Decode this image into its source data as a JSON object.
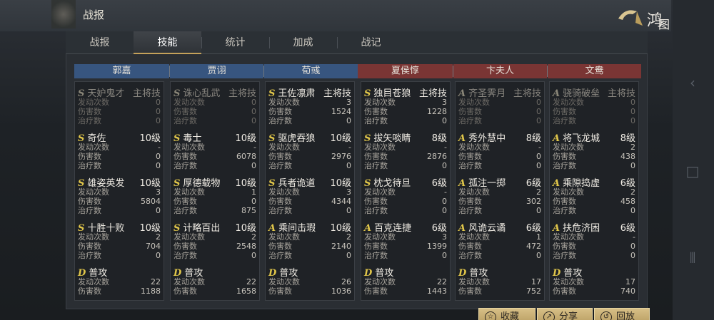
{
  "header": {
    "title": "战报",
    "brand": "鸿图之下"
  },
  "tabs": [
    "战报",
    "技能",
    "统计",
    "加成",
    "战记"
  ],
  "generals": [
    "郭嘉",
    "贾诩",
    "荀彧",
    "夏侯惇",
    "卞夫人",
    "文鸯"
  ],
  "labels": {
    "trigger": "发动次数",
    "damage": "伤害数",
    "heal": "治疗数"
  },
  "columns": [
    {
      "skills": [
        {
          "grade": "S",
          "name": "天妒鬼才",
          "level": "主将技",
          "dim": true,
          "rows": [
            [
              "发动次数",
              "0"
            ],
            [
              "伤害数",
              "0"
            ],
            [
              "治疗数",
              "0"
            ]
          ]
        },
        {
          "grade": "S",
          "name": "奇佐",
          "level": "10级",
          "rows": [
            [
              "发动次数",
              "-"
            ],
            [
              "伤害数",
              "0"
            ],
            [
              "治疗数",
              "0"
            ]
          ]
        },
        {
          "grade": "S",
          "name": "雄姿英发",
          "level": "10级",
          "rows": [
            [
              "发动次数",
              "3"
            ],
            [
              "伤害数",
              "5804"
            ],
            [
              "治疗数",
              "0"
            ]
          ]
        },
        {
          "grade": "S",
          "name": "十胜十败",
          "level": "10级",
          "rows": [
            [
              "发动次数",
              "2"
            ],
            [
              "伤害数",
              "704"
            ],
            [
              "治疗数",
              "0"
            ]
          ]
        },
        {
          "grade": "D",
          "name": "普攻",
          "level": "",
          "rows": [
            [
              "发动次数",
              "22"
            ],
            [
              "伤害数",
              "1188"
            ]
          ]
        }
      ]
    },
    {
      "skills": [
        {
          "grade": "S",
          "name": "诛心乱武",
          "level": "主将技",
          "dim": true,
          "rows": [
            [
              "发动次数",
              "0"
            ],
            [
              "伤害数",
              "0"
            ],
            [
              "治疗数",
              "0"
            ]
          ]
        },
        {
          "grade": "S",
          "name": "毒士",
          "level": "10级",
          "rows": [
            [
              "发动次数",
              "-"
            ],
            [
              "伤害数",
              "6078"
            ],
            [
              "治疗数",
              "0"
            ]
          ]
        },
        {
          "grade": "S",
          "name": "厚德载物",
          "level": "10级",
          "rows": [
            [
              "发动次数",
              "1"
            ],
            [
              "伤害数",
              "0"
            ],
            [
              "治疗数",
              "875"
            ]
          ]
        },
        {
          "grade": "S",
          "name": "计略百出",
          "level": "10级",
          "rows": [
            [
              "发动次数",
              "2"
            ],
            [
              "伤害数",
              "2548"
            ],
            [
              "治疗数",
              "0"
            ]
          ]
        },
        {
          "grade": "D",
          "name": "普攻",
          "level": "",
          "rows": [
            [
              "发动次数",
              "22"
            ],
            [
              "伤害数",
              "1658"
            ]
          ]
        }
      ]
    },
    {
      "skills": [
        {
          "grade": "S",
          "name": "王佐凛肃",
          "level": "主将技",
          "rows": [
            [
              "发动次数",
              "3"
            ],
            [
              "伤害数",
              "1524"
            ],
            [
              "治疗数",
              "0"
            ]
          ]
        },
        {
          "grade": "S",
          "name": "驱虎吞狼",
          "level": "10级",
          "rows": [
            [
              "发动次数",
              "-"
            ],
            [
              "伤害数",
              "2976"
            ],
            [
              "治疗数",
              "0"
            ]
          ]
        },
        {
          "grade": "S",
          "name": "兵者诡道",
          "level": "10级",
          "rows": [
            [
              "发动次数",
              "3"
            ],
            [
              "伤害数",
              "4344"
            ],
            [
              "治疗数",
              "0"
            ]
          ]
        },
        {
          "grade": "A",
          "name": "乘间击瑕",
          "level": "10级",
          "rows": [
            [
              "发动次数",
              "2"
            ],
            [
              "伤害数",
              "2140"
            ],
            [
              "治疗数",
              "0"
            ]
          ]
        },
        {
          "grade": "D",
          "name": "普攻",
          "level": "",
          "rows": [
            [
              "发动次数",
              "26"
            ],
            [
              "伤害数",
              "1036"
            ]
          ]
        }
      ]
    },
    {
      "skills": [
        {
          "grade": "S",
          "name": "独目苍狼",
          "level": "主将技",
          "rows": [
            [
              "发动次数",
              "3"
            ],
            [
              "伤害数",
              "1228"
            ],
            [
              "治疗数",
              "0"
            ]
          ]
        },
        {
          "grade": "S",
          "name": "拔矢啖睛",
          "level": "8级",
          "rows": [
            [
              "发动次数",
              "-"
            ],
            [
              "伤害数",
              "2876"
            ],
            [
              "治疗数",
              "0"
            ]
          ]
        },
        {
          "grade": "S",
          "name": "枕戈待旦",
          "level": "6级",
          "rows": [
            [
              "发动次数",
              "-"
            ],
            [
              "伤害数",
              "0"
            ],
            [
              "治疗数",
              "0"
            ]
          ]
        },
        {
          "grade": "A",
          "name": "百克连捷",
          "level": "6级",
          "rows": [
            [
              "发动次数",
              "3"
            ],
            [
              "伤害数",
              "1399"
            ],
            [
              "治疗数",
              "0"
            ]
          ]
        },
        {
          "grade": "D",
          "name": "普攻",
          "level": "",
          "rows": [
            [
              "发动次数",
              "22"
            ],
            [
              "伤害数",
              "1443"
            ]
          ]
        }
      ]
    },
    {
      "skills": [
        {
          "grade": "A",
          "name": "齐圣霁月",
          "level": "主将技",
          "dim": true,
          "rows": [
            [
              "发动次数",
              "0"
            ],
            [
              "伤害数",
              "0"
            ],
            [
              "治疗数",
              "0"
            ]
          ]
        },
        {
          "grade": "A",
          "name": "秀外慧中",
          "level": "8级",
          "rows": [
            [
              "发动次数",
              "-"
            ],
            [
              "伤害数",
              "0"
            ],
            [
              "治疗数",
              "0"
            ]
          ]
        },
        {
          "grade": "A",
          "name": "孤注一掷",
          "level": "6级",
          "rows": [
            [
              "发动次数",
              "2"
            ],
            [
              "伤害数",
              "302"
            ],
            [
              "治疗数",
              "0"
            ]
          ]
        },
        {
          "grade": "A",
          "name": "风诡云谲",
          "level": "6级",
          "rows": [
            [
              "发动次数",
              "1"
            ],
            [
              "伤害数",
              "472"
            ],
            [
              "治疗数",
              "0"
            ]
          ]
        },
        {
          "grade": "D",
          "name": "普攻",
          "level": "",
          "rows": [
            [
              "发动次数",
              "17"
            ],
            [
              "伤害数",
              "752"
            ]
          ]
        }
      ]
    },
    {
      "skills": [
        {
          "grade": "A",
          "name": "骁骑破垒",
          "level": "主将技",
          "dim": true,
          "rows": [
            [
              "发动次数",
              "0"
            ],
            [
              "伤害数",
              "0"
            ],
            [
              "治疗数",
              "0"
            ]
          ]
        },
        {
          "grade": "A",
          "name": "将飞龙城",
          "level": "8级",
          "rows": [
            [
              "发动次数",
              "2"
            ],
            [
              "伤害数",
              "438"
            ],
            [
              "治疗数",
              "0"
            ]
          ]
        },
        {
          "grade": "A",
          "name": "乘隙捣虚",
          "level": "6级",
          "rows": [
            [
              "发动次数",
              "2"
            ],
            [
              "伤害数",
              "458"
            ],
            [
              "治疗数",
              "0"
            ]
          ]
        },
        {
          "grade": "A",
          "name": "扶危济困",
          "level": "6级",
          "rows": [
            [
              "发动次数",
              "-"
            ],
            [
              "伤害数",
              "0"
            ],
            [
              "治疗数",
              "0"
            ]
          ]
        },
        {
          "grade": "D",
          "name": "普攻",
          "level": "",
          "rows": [
            [
              "发动次数",
              "17"
            ],
            [
              "伤害数",
              "740"
            ]
          ]
        }
      ]
    }
  ],
  "buttons": [
    "收藏",
    "分享",
    "回放"
  ]
}
